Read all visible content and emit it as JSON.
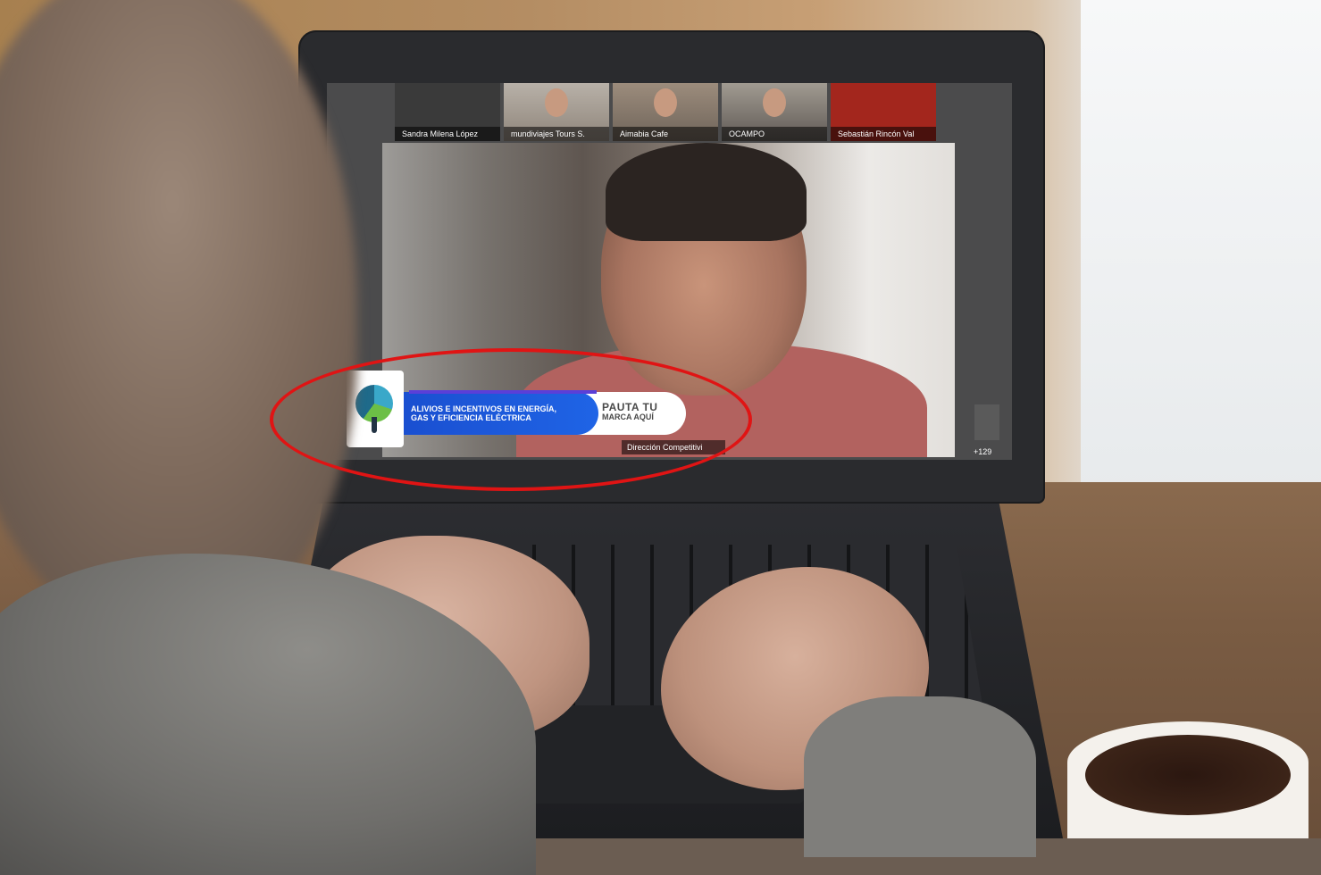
{
  "meeting": {
    "participants": [
      {
        "name": "Sandra Milena López"
      },
      {
        "name": "mundiviajes Tours S."
      },
      {
        "name": "Aimabia Cafe"
      },
      {
        "name": "OCAMPO"
      },
      {
        "name": "Sebastián Rincón Val"
      }
    ],
    "more_participants": "+129",
    "speaker_caption": "Dirección Competitivi"
  },
  "banner": {
    "headline_line1": "ALIVIOS E INCENTIVOS EN ENERGÍA,",
    "headline_line2": "GAS Y EFICIENCIA ELÉCTRICA",
    "cta_line1": "PAUTA TU",
    "cta_line2": "MARCA AQUÍ"
  },
  "colors": {
    "highlight": "#e01414",
    "banner_blue": "#1a4fd0",
    "tile_red": "#a3261d"
  }
}
